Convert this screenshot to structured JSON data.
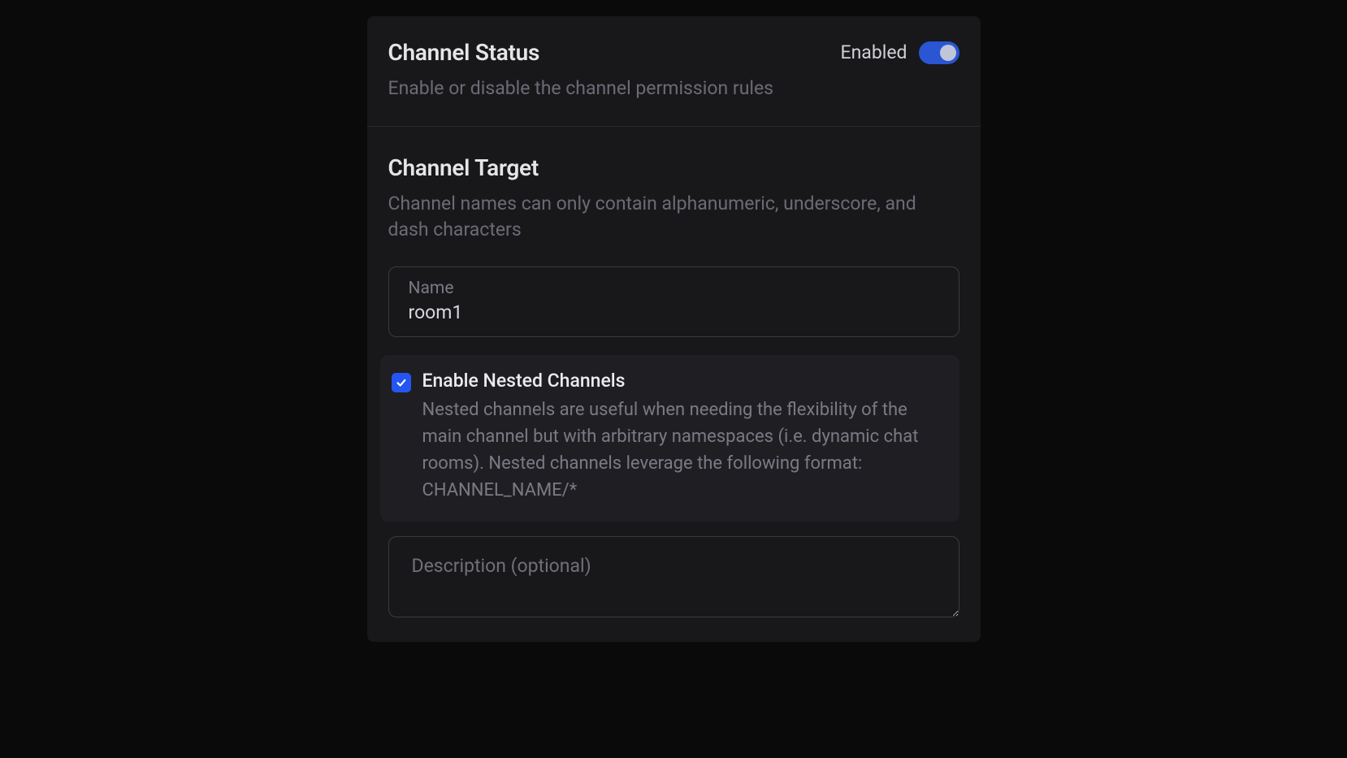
{
  "status": {
    "title": "Channel Status",
    "subtitle": "Enable or disable the channel permission rules",
    "toggle_label": "Enabled",
    "toggle_on": true
  },
  "target": {
    "title": "Channel Target",
    "subtitle": "Channel names can only contain alphanumeric, underscore, and dash characters",
    "name_label": "Name",
    "name_value": "room1",
    "nested": {
      "checked": true,
      "title": "Enable Nested Channels",
      "description": "Nested channels are useful when needing the flexibility of the main channel but with arbitrary namespaces (i.e. dynamic chat rooms). Nested channels leverage the following format: CHANNEL_NAME/*"
    },
    "description_placeholder": "Description (optional)",
    "description_value": ""
  }
}
